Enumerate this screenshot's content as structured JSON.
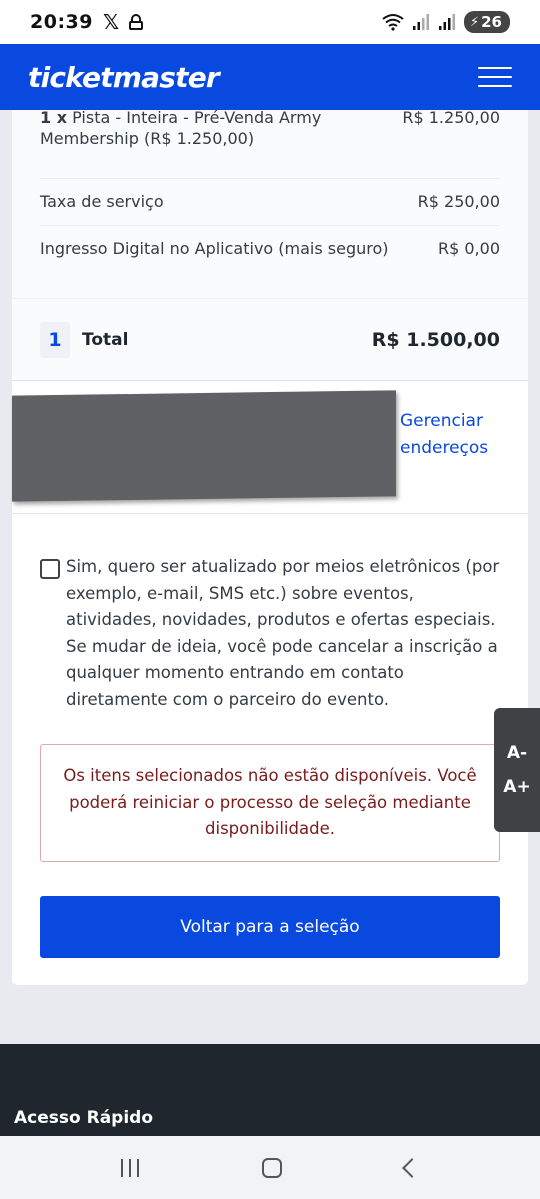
{
  "status_bar": {
    "time": "20:39",
    "x_app": "𝕏",
    "battery": "26"
  },
  "header": {
    "logo": "ticketmaster"
  },
  "order": {
    "ticket_qty": "1 x",
    "ticket_desc": "Pista - Inteira - Pré-Venda Army Membership (R$ 1.250,00)",
    "ticket_amount": "R$ 1.250,00",
    "fee_label": "Taxa de serviço",
    "fee_amount": "R$ 250,00",
    "digital_label": "Ingresso Digital no Aplicativo (mais seguro)",
    "digital_amount": "R$ 0,00",
    "total_qty": "1",
    "total_label": "Total",
    "total_amount": "R$ 1.500,00"
  },
  "address": {
    "manage_link": "Gerenciar endereços"
  },
  "consent": {
    "text": "Sim, quero ser atualizado por meios eletrônicos (por exemplo, e-mail, SMS etc.) sobre eventos, atividades, novidades, produtos e ofertas especiais. Se mudar de ideia, você pode cancelar a inscrição a qualquer momento entrando em contato diretamente com o parceiro do evento."
  },
  "error": {
    "message": "Os itens selecionados não estão disponíveis. Você poderá reiniciar o processo de seleção mediante disponibilidade."
  },
  "back_button": "Voltar para a seleção",
  "font_widget": {
    "decrease": "A-",
    "increase": "A+"
  },
  "footer": {
    "title": "Acesso Rápido"
  }
}
